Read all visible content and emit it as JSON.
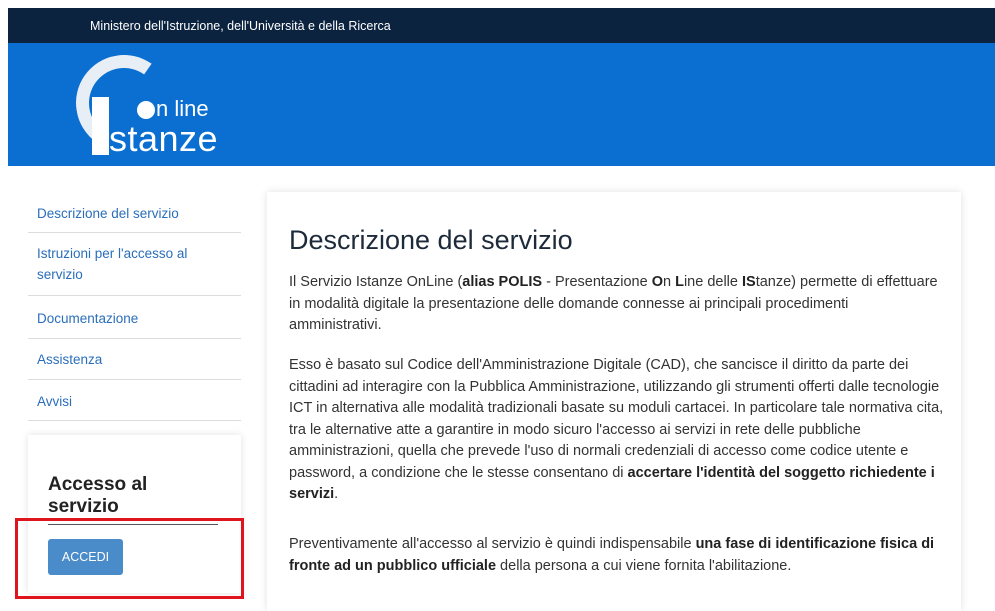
{
  "topbar": {
    "ministry": "Ministero dell'Istruzione, dell'Università e della Ricerca"
  },
  "logo": {
    "online": "n line",
    "stanze": "stanze"
  },
  "sidebar": {
    "items": [
      {
        "label": "Descrizione del servizio"
      },
      {
        "label": "Istruzioni per l'accesso al servizio"
      },
      {
        "label": "Documentazione"
      },
      {
        "label": "Assistenza"
      },
      {
        "label": "Avvisi"
      }
    ]
  },
  "access": {
    "title": "Accesso al servizio",
    "button": "ACCEDI"
  },
  "main": {
    "title": "Descrizione del servizio",
    "p1": [
      "Il Servizio Istanze OnLine (",
      "alias POLIS",
      " - Presentazione ",
      "O",
      "n ",
      "L",
      "ine delle ",
      "IS",
      "tanze) permette di effettuare in modalità digitale la presentazione delle domande connesse ai principali procedimenti amministrativi."
    ],
    "p2": [
      "Esso è basato sul Codice dell'Amministrazione Digitale (CAD), che sancisce il diritto da parte dei cittadini ad interagire con la Pubblica Amministrazione, utilizzando gli strumenti offerti dalle tecnologie ICT in alternativa alle modalità tradizionali basate su moduli cartacei. In particolare tale normativa cita, tra le alternative atte a garantire in modo sicuro l'accesso ai servizi in rete delle pubbliche amministrazioni, quella che prevede l'uso di normali credenziali di accesso come codice utente e password, a condizione che le stesse consentano di ",
      "accertare l'identità del soggetto richiedente i servizi",
      "."
    ],
    "p3": [
      "Preventivamente all'accesso al servizio è quindi indispensabile ",
      "una fase di identificazione fisica di fronte ad un pubblico ufficiale",
      " della persona a cui viene fornita l'abilitazione."
    ]
  },
  "colors": {
    "topbar": "#0c2340",
    "header": "#0b6fd2",
    "link": "#2a6ebb",
    "button": "#4a8cc9",
    "highlight": "#e0141c"
  }
}
